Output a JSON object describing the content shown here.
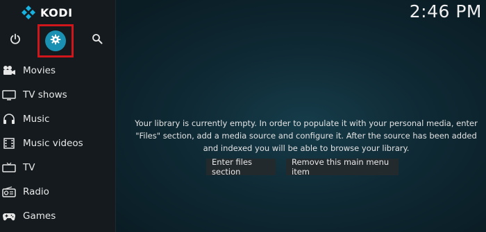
{
  "app": {
    "logo_text": "KODI",
    "clock": "2:46 PM"
  },
  "top_icons": {
    "power": "power-icon",
    "settings": "gear-icon",
    "search": "search-icon"
  },
  "menu": {
    "items": [
      {
        "label": "Movies",
        "icon": "movie-camera-icon"
      },
      {
        "label": "TV shows",
        "icon": "tv-icon"
      },
      {
        "label": "Music",
        "icon": "headphones-icon"
      },
      {
        "label": "Music videos",
        "icon": "film-strip-icon"
      },
      {
        "label": "TV",
        "icon": "tv-antenna-icon"
      },
      {
        "label": "Radio",
        "icon": "radio-icon"
      },
      {
        "label": "Games",
        "icon": "gamepad-icon"
      }
    ]
  },
  "main": {
    "message": "Your library is currently empty. In order to populate it with your personal media, enter \"Files\" section, add a media source and configure it. After the source has been added and indexed you will be able to browse your library.",
    "enter_files_label": "Enter files section",
    "remove_item_label": "Remove this main menu item"
  },
  "colors": {
    "accent": "#1a91b3",
    "highlight_box": "#d0161a",
    "sidebar_bg": "#141a1d"
  }
}
